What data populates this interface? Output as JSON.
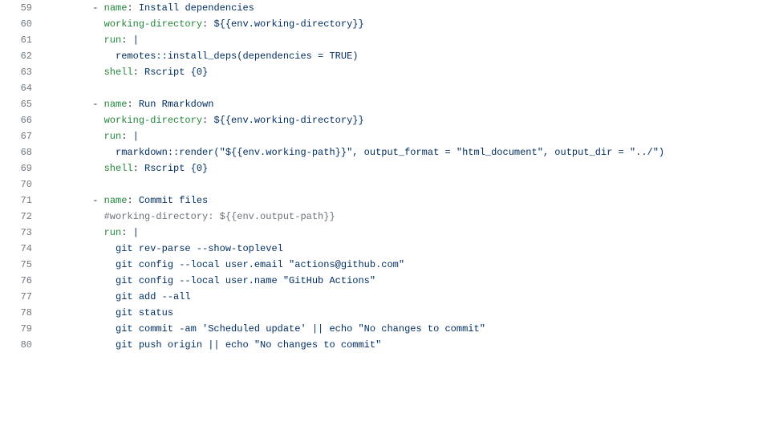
{
  "lines": [
    {
      "no": 59,
      "indent": "      ",
      "tokens": [
        {
          "t": "- ",
          "c": "pl-def"
        },
        {
          "t": "name",
          "c": "pl-ent"
        },
        {
          "t": ": ",
          "c": "pl-def"
        },
        {
          "t": "Install dependencies",
          "c": "pl-s"
        }
      ]
    },
    {
      "no": 60,
      "indent": "        ",
      "tokens": [
        {
          "t": "working-directory",
          "c": "pl-ent"
        },
        {
          "t": ": ",
          "c": "pl-def"
        },
        {
          "t": "${{env.working-directory}}",
          "c": "pl-s"
        }
      ]
    },
    {
      "no": 61,
      "indent": "        ",
      "tokens": [
        {
          "t": "run",
          "c": "pl-ent"
        },
        {
          "t": ": ",
          "c": "pl-def"
        },
        {
          "t": "|",
          "c": "pl-s"
        }
      ]
    },
    {
      "no": 62,
      "indent": "          ",
      "tokens": [
        {
          "t": "remotes::install_deps(dependencies = TRUE)",
          "c": "pl-s"
        }
      ]
    },
    {
      "no": 63,
      "indent": "        ",
      "tokens": [
        {
          "t": "shell",
          "c": "pl-ent"
        },
        {
          "t": ": ",
          "c": "pl-def"
        },
        {
          "t": "Rscript {0}",
          "c": "pl-s"
        }
      ]
    },
    {
      "no": 64,
      "indent": "",
      "tokens": []
    },
    {
      "no": 65,
      "indent": "      ",
      "tokens": [
        {
          "t": "- ",
          "c": "pl-def"
        },
        {
          "t": "name",
          "c": "pl-ent"
        },
        {
          "t": ": ",
          "c": "pl-def"
        },
        {
          "t": "Run Rmarkdown",
          "c": "pl-s"
        }
      ]
    },
    {
      "no": 66,
      "indent": "        ",
      "tokens": [
        {
          "t": "working-directory",
          "c": "pl-ent"
        },
        {
          "t": ": ",
          "c": "pl-def"
        },
        {
          "t": "${{env.working-directory}}",
          "c": "pl-s"
        }
      ]
    },
    {
      "no": 67,
      "indent": "        ",
      "tokens": [
        {
          "t": "run",
          "c": "pl-ent"
        },
        {
          "t": ": ",
          "c": "pl-def"
        },
        {
          "t": "|",
          "c": "pl-s"
        }
      ]
    },
    {
      "no": 68,
      "indent": "          ",
      "tokens": [
        {
          "t": "rmarkdown::render(\"${{env.working-path}}\", output_format = \"html_document\", output_dir = \"../\")",
          "c": "pl-s"
        }
      ]
    },
    {
      "no": 69,
      "indent": "        ",
      "tokens": [
        {
          "t": "shell",
          "c": "pl-ent"
        },
        {
          "t": ": ",
          "c": "pl-def"
        },
        {
          "t": "Rscript {0}",
          "c": "pl-s"
        }
      ]
    },
    {
      "no": 70,
      "indent": "",
      "tokens": []
    },
    {
      "no": 71,
      "indent": "      ",
      "tokens": [
        {
          "t": "- ",
          "c": "pl-def"
        },
        {
          "t": "name",
          "c": "pl-ent"
        },
        {
          "t": ": ",
          "c": "pl-def"
        },
        {
          "t": "Commit files",
          "c": "pl-s"
        }
      ]
    },
    {
      "no": 72,
      "indent": "        ",
      "tokens": [
        {
          "t": "#working-directory: ${{env.output-path}}",
          "c": "pl-c"
        }
      ]
    },
    {
      "no": 73,
      "indent": "        ",
      "tokens": [
        {
          "t": "run",
          "c": "pl-ent"
        },
        {
          "t": ": ",
          "c": "pl-def"
        },
        {
          "t": "|",
          "c": "pl-s"
        }
      ]
    },
    {
      "no": 74,
      "indent": "          ",
      "tokens": [
        {
          "t": "git rev-parse --show-toplevel",
          "c": "pl-s"
        }
      ]
    },
    {
      "no": 75,
      "indent": "          ",
      "tokens": [
        {
          "t": "git config --local user.email \"actions@github.com\"",
          "c": "pl-s"
        }
      ]
    },
    {
      "no": 76,
      "indent": "          ",
      "tokens": [
        {
          "t": "git config --local user.name \"GitHub Actions\"",
          "c": "pl-s"
        }
      ]
    },
    {
      "no": 77,
      "indent": "          ",
      "tokens": [
        {
          "t": "git add --all",
          "c": "pl-s"
        }
      ]
    },
    {
      "no": 78,
      "indent": "          ",
      "tokens": [
        {
          "t": "git status",
          "c": "pl-s"
        }
      ]
    },
    {
      "no": 79,
      "indent": "          ",
      "tokens": [
        {
          "t": "git commit -am 'Scheduled update' || echo \"No changes to commit\"",
          "c": "pl-s"
        }
      ]
    },
    {
      "no": 80,
      "indent": "          ",
      "tokens": [
        {
          "t": "git push origin || echo \"No changes to commit\"",
          "c": "pl-s"
        }
      ]
    }
  ]
}
